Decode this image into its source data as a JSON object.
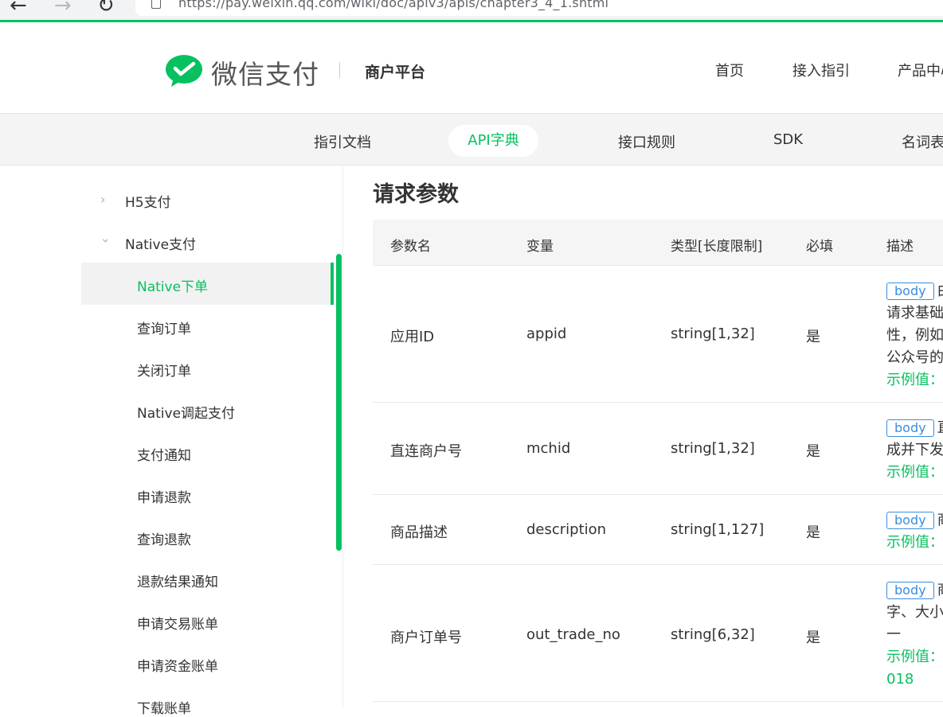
{
  "browser": {
    "back_icon": "←",
    "forward_icon": "→",
    "reload_icon": "↻",
    "url": "https://pay.weixin.qq.com/wiki/doc/apiv3/apis/chapter3_4_1.shtml"
  },
  "header": {
    "logo_text": "微信支付",
    "platform": "商户平台",
    "nav": [
      "首页",
      "接入指引",
      "产品中心"
    ],
    "brand_color": "#07c160"
  },
  "subnav": {
    "items": [
      "指引文档",
      "API字典",
      "接口规则",
      "SDK",
      "名词表"
    ],
    "active": "API字典"
  },
  "sidebar": {
    "groups": [
      {
        "label": "H5支付",
        "expanded": false
      },
      {
        "label": "Native支付",
        "expanded": true
      }
    ],
    "active_item": "Native下单",
    "items": [
      "查询订单",
      "关闭订单",
      "Native调起支付",
      "支付通知",
      "申请退款",
      "查询退款",
      "退款结果通知",
      "申请交易账单",
      "申请资金账单",
      "下载账单"
    ]
  },
  "content": {
    "section_title": "请求参数",
    "table": {
      "headers": [
        "参数名",
        "变量",
        "类型[长度限制]",
        "必填",
        "描述"
      ],
      "rows": [
        {
          "name": "应用ID",
          "var": "appid",
          "type": "string[1,32]",
          "required": "是",
          "desc_tag": "body",
          "desc_first": "由",
          "desc_lines": [
            "请求基础",
            "性，例如",
            "公众号的"
          ],
          "example": "示例值：w"
        },
        {
          "name": "直连商户号",
          "var": "mchid",
          "type": "string[1,32]",
          "required": "是",
          "desc_tag": "body",
          "desc_first": "直",
          "desc_lines": [
            "成并下发"
          ],
          "example": "示例值："
        },
        {
          "name": "商品描述",
          "var": "description",
          "type": "string[1,127]",
          "required": "是",
          "desc_tag": "body",
          "desc_first": "商",
          "desc_lines": [],
          "example": "示例值："
        },
        {
          "name": "商户订单号",
          "var": "out_trade_no",
          "type": "string[6,32]",
          "required": "是",
          "desc_tag": "body",
          "desc_first": "商",
          "desc_lines": [
            "字、大小",
            "一"
          ],
          "example": "示例值：",
          "example_tail": "018"
        }
      ]
    }
  }
}
